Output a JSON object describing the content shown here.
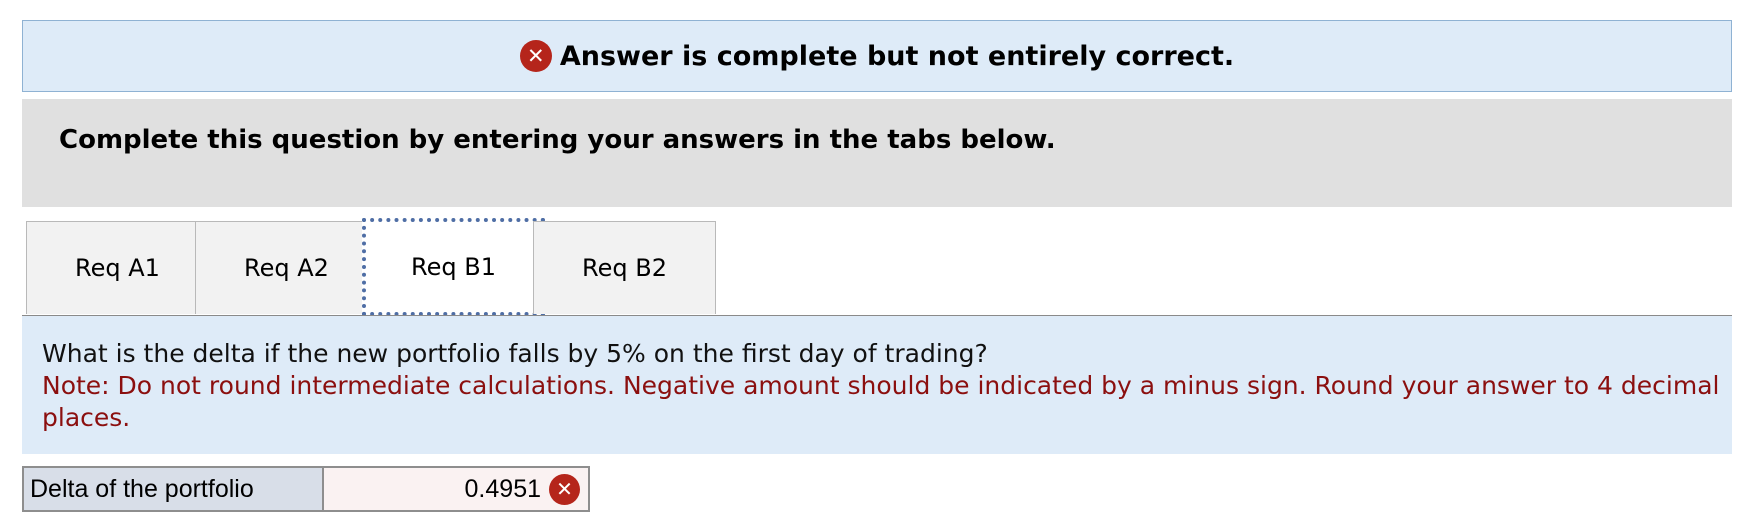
{
  "banner": {
    "status_icon": "x-circle-icon",
    "message": "Answer is complete but not entirely correct."
  },
  "instructions": {
    "text": "Complete this question by entering your answers in the tabs below."
  },
  "tabs": [
    {
      "label": "Req A1",
      "active": false
    },
    {
      "label": "Req A2",
      "active": false
    },
    {
      "label": "Req B1",
      "active": true
    },
    {
      "label": "Req B2",
      "active": false
    }
  ],
  "question": {
    "prompt": "What is the delta if the new portfolio falls by 5% on the first day of trading?",
    "note": "Note: Do not round intermediate calculations. Negative amount should be indicated by a minus sign. Round your answer to 4 decimal places."
  },
  "answer": {
    "label": "Delta of the portfolio",
    "value": "0.4951",
    "status_icon": "x-circle-icon"
  },
  "colors": {
    "error_red": "#b5251b",
    "note_red": "#8b0f0f",
    "panel_blue": "#deebf8",
    "active_tab_border": "#4f6ea5"
  }
}
